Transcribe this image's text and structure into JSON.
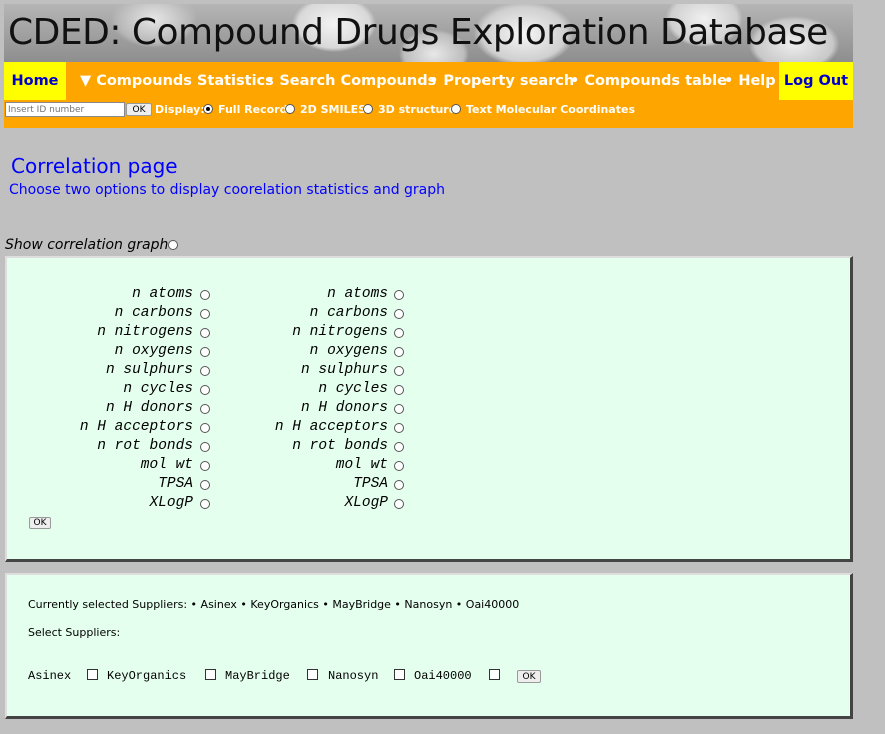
{
  "banner": {
    "title": "CDED: Compound Drugs Exploration Database"
  },
  "nav": {
    "home": "Home",
    "items": [
      "▼ Compounds Statistics",
      "• Search Compounds",
      "• Property search",
      "• Compounds table",
      "• Help"
    ],
    "logout": "Log Out"
  },
  "toolbar": {
    "id_placeholder": "Insert ID number",
    "ok": "OK",
    "display_label": "Display:",
    "options": [
      "Full Record",
      "2D SMILES",
      "3D structure",
      "Text Molecular Coordinates"
    ],
    "selected_option": "Full Record"
  },
  "page": {
    "title": "Correlation page",
    "subtitle": "Choose two options to display coorelation statistics and  graph",
    "show_graph": "Show correlation graph"
  },
  "properties": [
    "n atoms",
    "n carbons",
    "n nitrogens",
    "n oxygens",
    "n sulphurs",
    "n cycles",
    "n H donors",
    "n H acceptors",
    "n rot bonds",
    "mol wt",
    "TPSA",
    "XLogP"
  ],
  "correlation_ok": "OK",
  "suppliers": {
    "current_text": "Currently selected Suppliers: • Asinex • KeyOrganics • MayBridge • Nanosyn • Oai40000",
    "select_label": "Select Suppliers:",
    "names": [
      "Asinex",
      "KeyOrganics",
      "MayBridge",
      "Nanosyn",
      "Oai40000"
    ],
    "ok": "OK"
  },
  "colors": {
    "nav_bg": "#ffa500",
    "highlight": "#ffff00",
    "link_blue": "#0000ff",
    "panel_bg": "#e5ffee"
  }
}
